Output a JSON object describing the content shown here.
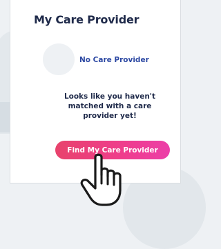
{
  "card": {
    "title": "My Care Provider",
    "status": "No Care Provider",
    "message": "Looks like you haven't matched with a care provider yet!",
    "cta_label": "Find My Care Provider"
  },
  "icons": {
    "pointer": "hand-pointer-icon",
    "avatar": "avatar-placeholder"
  },
  "colors": {
    "title": "#1f2a4a",
    "status": "#2d49a3",
    "cta_gradient": [
      "#e8436c",
      "#ef3d8d",
      "#ec3ea8"
    ],
    "background": "#eef1f4"
  }
}
